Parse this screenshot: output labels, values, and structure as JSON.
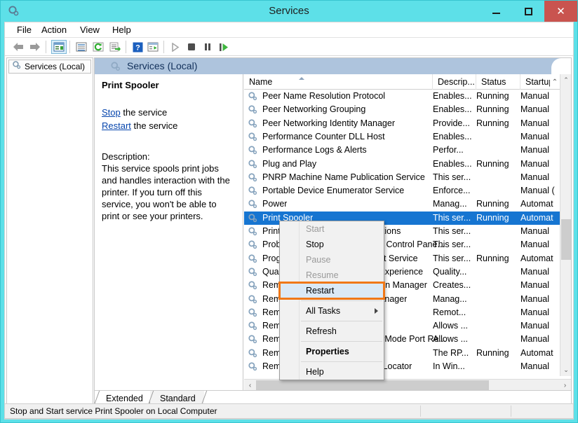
{
  "window": {
    "title": "Services",
    "app_icon": "services-gear-icon",
    "buttons": {
      "minimize": "–",
      "maximize": "□",
      "close": "✕"
    },
    "colors": {
      "titlebar": "#5de0e8",
      "close": "#c9544f",
      "selection": "#1675d1",
      "highlight_outline": "#f07818",
      "banner": "#aec4dd"
    }
  },
  "menubar": {
    "items": [
      "File",
      "Action",
      "View",
      "Help"
    ]
  },
  "toolbar": {
    "buttons": [
      {
        "name": "back-arrow-icon",
        "glyph": "←"
      },
      {
        "name": "forward-arrow-icon",
        "glyph": "→"
      },
      {
        "name": "show-hide-console-tree-icon",
        "glyph": "▤"
      },
      {
        "name": "properties-icon",
        "glyph": "▤"
      },
      {
        "name": "refresh-icon",
        "glyph": "↻"
      },
      {
        "name": "export-list-icon",
        "glyph": "▤"
      },
      {
        "name": "help-icon",
        "glyph": "?"
      },
      {
        "name": "show-action-pane-icon",
        "glyph": "▤"
      },
      {
        "name": "start-service-icon",
        "glyph": "▶"
      },
      {
        "name": "stop-service-icon",
        "glyph": "■"
      },
      {
        "name": "pause-service-icon",
        "glyph": "‖"
      },
      {
        "name": "restart-service-icon",
        "glyph": "▶"
      }
    ]
  },
  "tree": {
    "root_label": "Services (Local)"
  },
  "banner": {
    "label": "Services (Local)"
  },
  "details": {
    "service_name": "Print Spooler",
    "link_stop": "Stop",
    "link_stop_suffix": " the service",
    "link_restart": "Restart",
    "link_restart_suffix": " the service",
    "description_label": "Description:",
    "description_text": "This service spools print jobs and handles interaction with the printer. If you turn off this service, you won't be able to print or see your printers."
  },
  "list": {
    "columns": [
      {
        "label": "Name",
        "sorted": true
      },
      {
        "label": "Descrip...",
        "sorted": false
      },
      {
        "label": "Status",
        "sorted": false
      },
      {
        "label": "Startup T",
        "sorted": false
      }
    ],
    "rows": [
      {
        "name": "Peer Name Resolution Protocol",
        "desc": "Enables...",
        "status": "Running",
        "startup": "Manual",
        "selected": false
      },
      {
        "name": "Peer Networking Grouping",
        "desc": "Enables...",
        "status": "Running",
        "startup": "Manual",
        "selected": false
      },
      {
        "name": "Peer Networking Identity Manager",
        "desc": "Provide...",
        "status": "Running",
        "startup": "Manual",
        "selected": false
      },
      {
        "name": "Performance Counter DLL Host",
        "desc": "Enables...",
        "status": "",
        "startup": "Manual",
        "selected": false
      },
      {
        "name": "Performance Logs & Alerts",
        "desc": "Perfor...",
        "status": "",
        "startup": "Manual",
        "selected": false
      },
      {
        "name": "Plug and Play",
        "desc": "Enables...",
        "status": "Running",
        "startup": "Manual",
        "selected": false
      },
      {
        "name": "PNRP Machine Name Publication Service",
        "desc": "This ser...",
        "status": "",
        "startup": "Manual",
        "selected": false
      },
      {
        "name": "Portable Device Enumerator Service",
        "desc": "Enforce...",
        "status": "",
        "startup": "Manual (",
        "selected": false
      },
      {
        "name": "Power",
        "desc": "Manag...",
        "status": "Running",
        "startup": "Automat",
        "selected": false
      },
      {
        "name": "Print Spooler",
        "desc": "This ser...",
        "status": "Running",
        "startup": "Automat",
        "selected": true
      },
      {
        "name": "Printer Extensions and Notifications",
        "desc": "This ser...",
        "status": "",
        "startup": "Manual",
        "selected": false
      },
      {
        "name": "Problem Reports and Solutions Control Pane...",
        "desc": "This ser...",
        "status": "",
        "startup": "Manual",
        "selected": false
      },
      {
        "name": "Program Compatibility Assistant Service",
        "desc": "This ser...",
        "status": "Running",
        "startup": "Automat",
        "selected": false
      },
      {
        "name": "Quality Windows Audio Video Experience",
        "desc": "Quality...",
        "status": "",
        "startup": "Manual",
        "selected": false
      },
      {
        "name": "Remote Access Auto Connection Manager",
        "desc": "Creates...",
        "status": "",
        "startup": "Manual",
        "selected": false
      },
      {
        "name": "Remote Access Connection Manager",
        "desc": "Manag...",
        "status": "",
        "startup": "Manual",
        "selected": false
      },
      {
        "name": "Remote Desktop Configuration",
        "desc": "Remot...",
        "status": "",
        "startup": "Manual",
        "selected": false
      },
      {
        "name": "Remote Desktop Services",
        "desc": "Allows ...",
        "status": "",
        "startup": "Manual",
        "selected": false
      },
      {
        "name": "Remote Desktop Services UserMode Port Re...",
        "desc": "Allows ...",
        "status": "",
        "startup": "Manual",
        "selected": false
      },
      {
        "name": "Remote Procedure Call (RPC)",
        "desc": "The RP...",
        "status": "Running",
        "startup": "Automat",
        "selected": false
      },
      {
        "name": "Remote Procedure Call (RPC) Locator",
        "desc": "In Win...",
        "status": "",
        "startup": "Manual",
        "selected": false
      }
    ],
    "scroll": {
      "up_arrow": "⌃",
      "down_arrow": "⌄",
      "left_arrow": "‹",
      "right_arrow": "›"
    }
  },
  "context_menu": {
    "items": [
      {
        "label": "Start",
        "state": "disabled",
        "separator_after": false,
        "submenu": false
      },
      {
        "label": "Stop",
        "state": "normal",
        "separator_after": false,
        "submenu": false
      },
      {
        "label": "Pause",
        "state": "disabled",
        "separator_after": false,
        "submenu": false
      },
      {
        "label": "Resume",
        "state": "disabled",
        "separator_after": false,
        "submenu": false
      },
      {
        "label": "Restart",
        "state": "highlighted",
        "separator_after": true,
        "submenu": false
      },
      {
        "label": "All Tasks",
        "state": "normal",
        "separator_after": true,
        "submenu": true
      },
      {
        "label": "Refresh",
        "state": "normal",
        "separator_after": true,
        "submenu": false
      },
      {
        "label": "Properties",
        "state": "bold",
        "separator_after": true,
        "submenu": false
      },
      {
        "label": "Help",
        "state": "normal",
        "separator_after": false,
        "submenu": false
      }
    ]
  },
  "tabs": [
    {
      "label": "Extended",
      "active": true
    },
    {
      "label": "Standard",
      "active": false
    }
  ],
  "statusbar": {
    "text": "Stop and Start service Print Spooler on Local Computer"
  }
}
